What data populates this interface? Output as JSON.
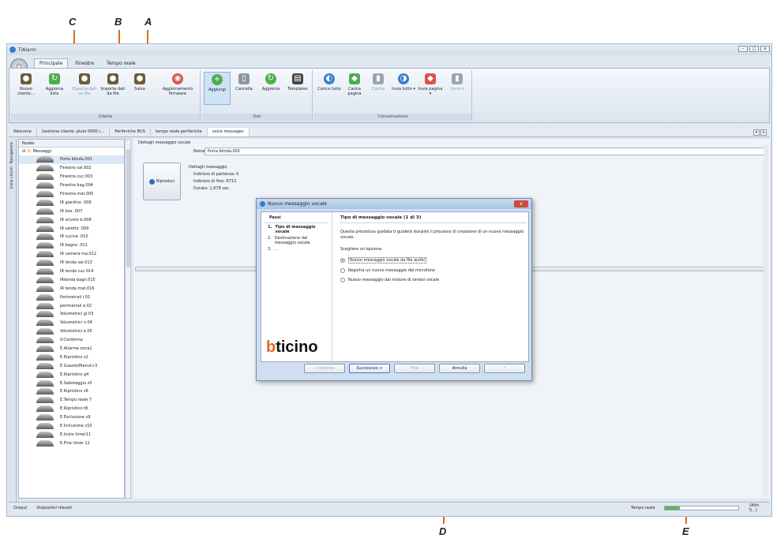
{
  "callouts": {
    "a": "A",
    "b": "B",
    "c": "C",
    "d": "D",
    "e": "E"
  },
  "window": {
    "title": "TiAlarm"
  },
  "ribbon": {
    "tabs": [
      "Principale",
      "Finestre",
      "Tempo reale"
    ],
    "groups": {
      "cliente": "Cliente",
      "dati": "Dati",
      "comunicazione": "Comunicazione"
    },
    "buttons": {
      "nuovo_cliente": "Nuovo cliente...",
      "aggiorna_lista": "Aggiorna lista",
      "esporta_dati": "Esporta dati su file",
      "importa_dati": "Importa dati da file",
      "salva": "Salva",
      "aggiornamento_firmware": "Aggiornamento firmware",
      "aggiungi": "Aggiungi",
      "cancella": "Cancella",
      "aggiorna": "Aggiorna",
      "templates": "Templates",
      "carica_tutto": "Carica tutto",
      "carica_pagina": "Carica pagina",
      "carica": "Carica",
      "invia_tutto": "Invia tutto ▾",
      "invia_pagina": "Invia pagina ▾",
      "invia": "Invia ▾"
    }
  },
  "doc_tabs": [
    "Welcome",
    "Gestione cliente: pluto 0000 (…",
    "Periferiche BUS",
    "tempo reale periferiche",
    "voice messages"
  ],
  "side_strip": {
    "navigatore": "Navigatore",
    "lista_clienti": "Lista clienti"
  },
  "tree": {
    "header": "Nodes",
    "root": "Messaggi",
    "items": [
      "Porta blinda.001",
      "Finestra sal.002",
      "Finestra cuc.003",
      "Finestra bag.004",
      "Finestra mat.005",
      "IR giardino .006",
      "IR box     .007",
      "IR scivolo b.008",
      "IR salotto  .009",
      "IR cucina   .010",
      "IR bagno    .011",
      "IR camera ma.012",
      "IR tenda sal.013",
      "IR tenda cuc.014",
      "IRtenda bagn.015",
      "IR tenda mat.016",
      "Perimetrali i.01",
      "perimetrali e.02",
      "Volumetrici gi.03",
      "Volumetrici n.04",
      "Volumetrici e.05",
      "V.Conferma",
      "E.Allarme zona1",
      "E.Ripristino z2",
      "E.Guasto/Manut>3",
      "E.Ripristino g4",
      "E.Sabotaggio z5",
      "E.Ripristino s6",
      "E.Tempo reale 7",
      "E.Ripristino t8",
      "E.Esclusione z9",
      "E.Inclusione z10",
      "E.Inizio timer11",
      "E.Fine timer  12"
    ]
  },
  "detail": {
    "section_label": "Dettagli messaggio vocale",
    "name_label": "Nome",
    "name_value": "Porta blinda.001",
    "play_label": "Riproduci",
    "msg_details_label": "Dettagli messaggio",
    "start_address": "Indirizzo di partenza: 0",
    "end_address": "Indirizzo di fine: 6713",
    "duration": "Durata: 1,678 sec."
  },
  "dialog": {
    "title": "Nuovo messaggio vocale",
    "steps_header": "Passi",
    "steps": [
      {
        "n": "1.",
        "label": "Tipo di messaggio vocale"
      },
      {
        "n": "2.",
        "label": "Destinazione del messaggio vocale"
      },
      {
        "n": "3.",
        "label": "..."
      }
    ],
    "content_header": "Tipo di messaggio vocale (1 di 3)",
    "intro": "Questa procedura guidata ti guiderà durante il processo di creazione di un nuovo messaggio vocale.",
    "choose": "Scegliere un'opzione:",
    "options": [
      "Nuovo messaggio vocale da file audio",
      "Registra un nuovo messaggio dal microfono",
      "Nuovo messaggio dal motore di sintesi vocale"
    ],
    "selected_option": 0,
    "logo_b": "b",
    "logo_rest": "ticino",
    "buttons": {
      "back": "< Indietro",
      "next": "Successivo >",
      "finish": "Fine",
      "cancel": "Annulla",
      "help": "?"
    }
  },
  "status": {
    "output": "Output",
    "devices": "Dispositivi rilevati",
    "realtime": "Tempo reale",
    "other": "(Altri 5...)",
    "progress": 0.2
  },
  "colors": {
    "accent_orange": "#e06a1b",
    "ribbon_blue": "#dfe7f0"
  }
}
